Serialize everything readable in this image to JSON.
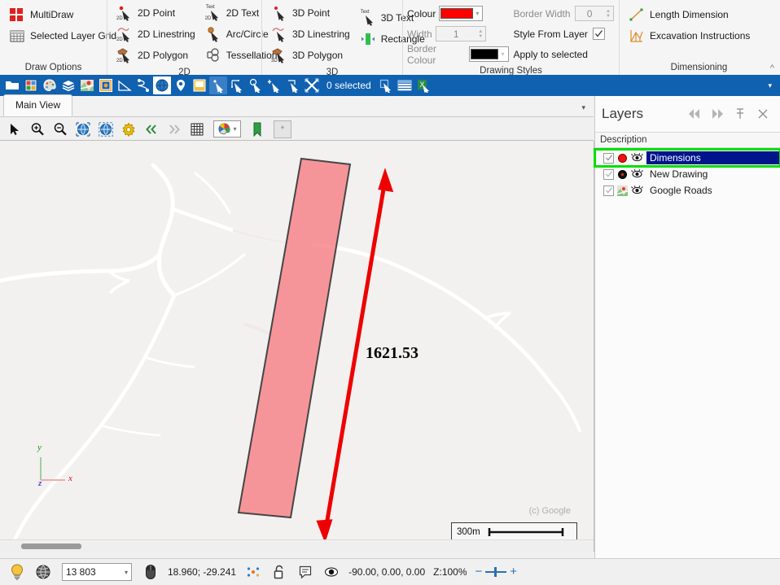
{
  "ribbon": {
    "groups": [
      {
        "title": "Draw Options",
        "items": [
          {
            "label": "MultiDraw",
            "icon": "multidraw-icon"
          },
          {
            "label": "Selected Layer Grid",
            "icon": "grid-icon"
          }
        ]
      },
      {
        "title": "2D",
        "col1": [
          {
            "label": "2D Point",
            "icon": "2d-point-icon"
          },
          {
            "label": "2D Linestring",
            "icon": "2d-linestring-icon"
          },
          {
            "label": "2D Polygon",
            "icon": "2d-polygon-icon"
          }
        ],
        "col2": [
          {
            "label": "2D Text",
            "icon": "2d-text-icon"
          },
          {
            "label": "Arc/Circle",
            "icon": "arc-circle-icon"
          },
          {
            "label": "Tessellation",
            "icon": "tessellation-icon"
          }
        ]
      },
      {
        "title": "3D",
        "col1": [
          {
            "label": "3D Point",
            "icon": "3d-point-icon"
          },
          {
            "label": "3D Linestring",
            "icon": "3d-linestring-icon"
          },
          {
            "label": "3D Polygon",
            "icon": "3d-polygon-icon"
          }
        ],
        "col2": [
          {
            "label": "3D Text",
            "icon": "3d-text-icon"
          },
          {
            "label": "Rectangle",
            "icon": "rectangle-icon"
          }
        ]
      },
      {
        "title": "Drawing Styles",
        "colour_label": "Colour",
        "colour_value": "#ff0000",
        "width_label": "Width",
        "width_value": "1",
        "border_colour_label": "Border Colour",
        "border_colour_value": "#000000",
        "border_width_label": "Border Width",
        "border_width_value": "0",
        "style_from_layer_label": "Style From Layer",
        "style_from_layer_checked": true,
        "apply_to_selected_label": "Apply to selected"
      },
      {
        "title": "Dimensioning",
        "items": [
          {
            "label": "Length Dimension",
            "icon": "length-dimension-icon"
          },
          {
            "label": "Excavation Instructions",
            "icon": "excavation-instructions-icon"
          }
        ]
      }
    ],
    "collapse_label": "^"
  },
  "quickbar": {
    "selected_text": "0 selected",
    "buttons": [
      {
        "name": "open-folder-icon"
      },
      {
        "name": "project-icon"
      },
      {
        "name": "palette-icon"
      },
      {
        "name": "layers-icon"
      },
      {
        "name": "google-map-icon"
      },
      {
        "name": "image-overlay-icon"
      },
      {
        "name": "measure-angle-icon"
      },
      {
        "name": "draw-curve-icon"
      },
      {
        "name": "globe-icon"
      },
      {
        "name": "marker-pin-icon"
      },
      {
        "name": "note-icon"
      },
      {
        "name": "select-pointer-icon"
      },
      {
        "name": "select-rectangle-icon"
      },
      {
        "name": "select-circle-icon"
      },
      {
        "name": "select-add-icon"
      },
      {
        "name": "select-crop-icon"
      },
      {
        "name": "deselect-icon"
      }
    ],
    "after_buttons": [
      {
        "name": "copy-selection-icon"
      },
      {
        "name": "table-view-icon"
      },
      {
        "name": "export-excel-icon"
      }
    ],
    "overflow_caret": "▾"
  },
  "view_tabs": {
    "tabs": [
      {
        "label": "Main View"
      }
    ],
    "caret": "▾"
  },
  "view_toolbar": {
    "buttons": [
      {
        "name": "pointer-tool-icon"
      },
      {
        "name": "zoom-in-icon"
      },
      {
        "name": "zoom-out-icon"
      },
      {
        "name": "zoom-extents-icon"
      },
      {
        "name": "zoom-selected-icon"
      },
      {
        "name": "view-settings-gear-icon"
      },
      {
        "name": "previous-view-icon"
      },
      {
        "name": "next-view-icon"
      },
      {
        "name": "grid-toggle-icon"
      },
      {
        "name": "colour-picker-icon"
      },
      {
        "name": "bookmark-icon"
      },
      {
        "name": "snapshot-icon"
      }
    ],
    "snapshot_glyph": "*"
  },
  "map": {
    "dimension_label": "1621.53",
    "attribution": "(c) Google",
    "scale_label": "300m",
    "axis": {
      "x": "x",
      "y": "y",
      "z": "z"
    },
    "polygon_fill": "#f77b80",
    "polygon_border": "#454545",
    "dimension_colour": "#ee0000"
  },
  "layers_panel": {
    "title": "Layers",
    "header_buttons": [
      {
        "name": "collapse-left-icon",
        "glyph": "◀◀"
      },
      {
        "name": "expand-right-icon",
        "glyph": "▶▶"
      },
      {
        "name": "pin-panel-icon",
        "glyph": "pin"
      },
      {
        "name": "close-panel-icon",
        "glyph": "✕"
      }
    ],
    "column_header": "Description",
    "rows": [
      {
        "label": "Dimensions",
        "selected": true,
        "highlighted": true,
        "checked": true,
        "swatch": "red-circle",
        "visible": true
      },
      {
        "label": "New Drawing",
        "selected": false,
        "highlighted": false,
        "checked": true,
        "swatch": "black-circle",
        "visible": true
      },
      {
        "label": "Google Roads",
        "selected": false,
        "highlighted": false,
        "checked": true,
        "swatch": "map-thumb",
        "visible": true
      }
    ]
  },
  "status_bar": {
    "lightbulb_icon": "hint-lightbulb-icon",
    "globe_icon": "projection-globe-icon",
    "count_value": "13 803",
    "count_caret": "▾",
    "mouse_icon": "mouse-icon",
    "coordinates": "18.960; -29.241",
    "snap_icon": "snap-points-icon",
    "lock_icon": "unlock-icon",
    "message_icon": "message-icon",
    "eye_icon": "view-direction-icon",
    "view_angles": "-90.00, 0.00, 0.00",
    "zoom_label": "Z:100%",
    "zoom_minus": "−",
    "zoom_plus": "+"
  }
}
